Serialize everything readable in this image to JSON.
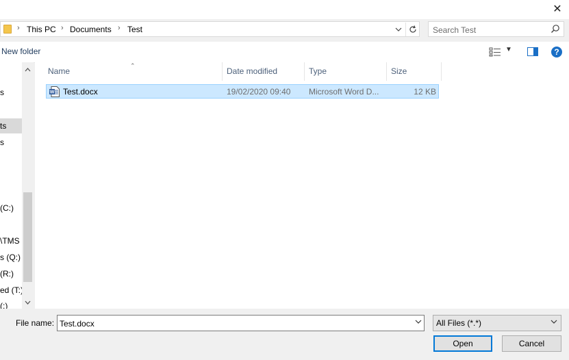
{
  "titlebar": {
    "close_glyph": "✕"
  },
  "address": {
    "crumbs": [
      "This PC",
      "Documents",
      "Test"
    ],
    "separator": "›"
  },
  "search": {
    "placeholder": "Search Test"
  },
  "toolbar": {
    "new_folder": "New folder",
    "help_glyph": "?"
  },
  "nav": {
    "items": [
      {
        "label": "s"
      },
      {
        "label": "ts",
        "selected": true
      },
      {
        "label": "s"
      },
      {
        "label": "(C:)"
      },
      {
        "label": "\\TMS"
      },
      {
        "label": "s (Q:)"
      },
      {
        "label": "(R:)"
      },
      {
        "label": "ed (T:)"
      },
      {
        "label": "(:)"
      }
    ]
  },
  "columns": [
    {
      "label": "Name"
    },
    {
      "label": "Date modified"
    },
    {
      "label": "Type"
    },
    {
      "label": "Size"
    }
  ],
  "files": [
    {
      "name": "Test.docx",
      "date": "19/02/2020 09:40",
      "type": "Microsoft Word D...",
      "size": "12 KB"
    }
  ],
  "bottom": {
    "filename_label": "File name:",
    "filename_value": "Test.docx",
    "filter": "All Files (*.*)",
    "open": "Open",
    "cancel": "Cancel"
  },
  "colors": {
    "accent": "#0078d7",
    "selection": "#cce8ff",
    "selection_border": "#99d1ff"
  }
}
